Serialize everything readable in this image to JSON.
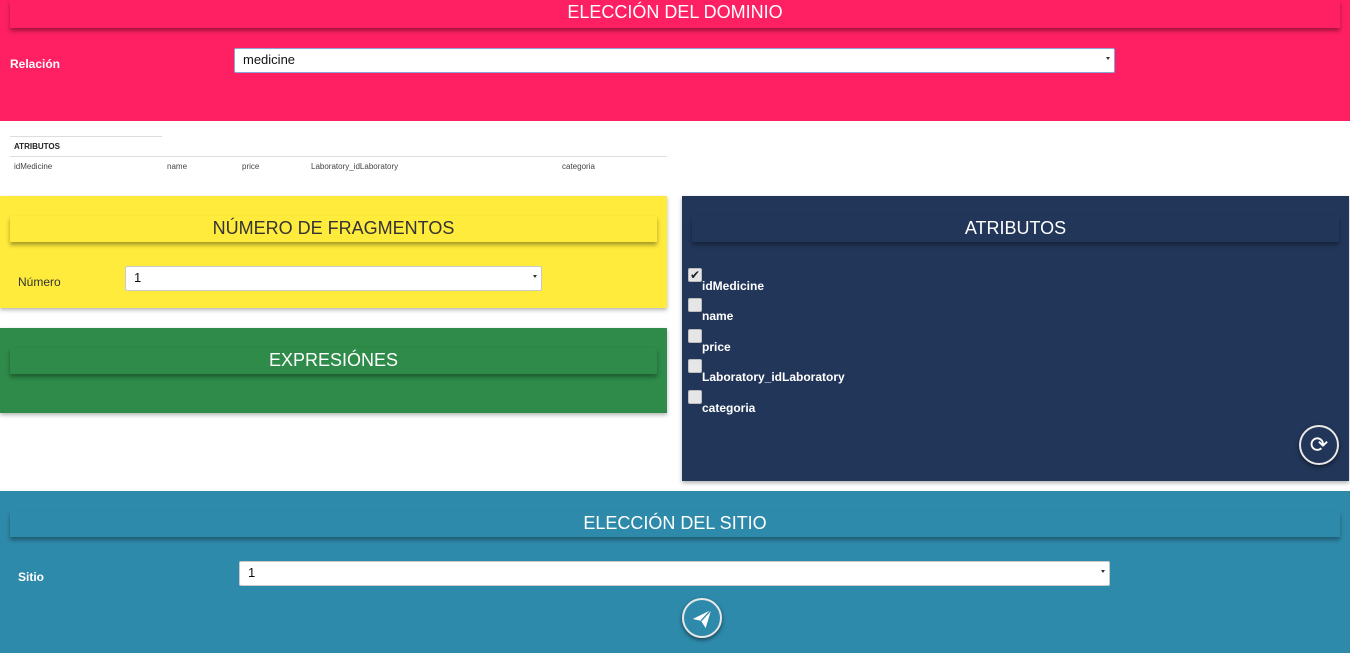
{
  "domain": {
    "title": "ELECCIÓN DEL DOMINIO",
    "relation_label": "Relación",
    "relation_value": "medicine"
  },
  "attr_table": {
    "title": "ATRIBUTOS",
    "columns": [
      "idMedicine",
      "name",
      "price",
      "Laboratory_idLaboratory",
      "categoria"
    ]
  },
  "fragments": {
    "title": "NÚMERO DE FRAGMENTOS",
    "number_label": "Número",
    "number_value": "1"
  },
  "expressions": {
    "title": "EXPRESIÓNES"
  },
  "attributes": {
    "title": "ATRIBUTOS",
    "items": [
      {
        "label": "idMedicine",
        "checked": true
      },
      {
        "label": "name",
        "checked": false
      },
      {
        "label": "price",
        "checked": false
      },
      {
        "label": "Laboratory_idLaboratory",
        "checked": false
      },
      {
        "label": "categoria",
        "checked": false
      }
    ],
    "refresh_icon": "refresh-icon"
  },
  "site": {
    "title": "ELECCIÓN DEL SITIO",
    "site_label": "Sitio",
    "site_value": "1",
    "send_icon": "paper-plane-icon"
  },
  "colors": {
    "domain": "#ff1f63",
    "fragments": "#ffeb3b",
    "expressions": "#2e8b4a",
    "attributes": "#223659",
    "site": "#2e8aab"
  }
}
